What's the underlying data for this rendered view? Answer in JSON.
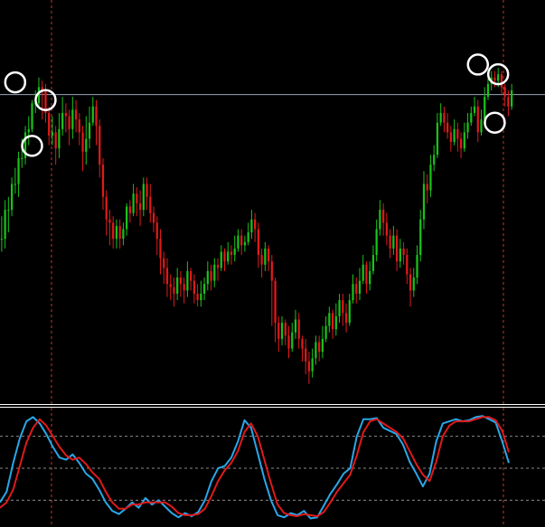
{
  "window": {
    "background": "#000000",
    "separator_color": "#ffffff",
    "grid_color": "#8a8a8a",
    "vline_color": "#c0392b"
  },
  "chart_data": [
    {
      "type": "candlestick",
      "colors": {
        "bull": "#19c219",
        "bear": "#e01a1a",
        "level": "#9aa6b8",
        "marker": "#ffffff"
      },
      "candles": [
        [
          0.47,
          0.47,
          0.43,
          0.54
        ],
        [
          0.47,
          0.56,
          0.44,
          0.59
        ],
        [
          0.56,
          0.56,
          0.49,
          0.6
        ],
        [
          0.56,
          0.64,
          0.54,
          0.66
        ],
        [
          0.64,
          0.64,
          0.61,
          0.69
        ],
        [
          0.64,
          0.72,
          0.6,
          0.74
        ],
        [
          0.72,
          0.72,
          0.69,
          0.78
        ],
        [
          0.72,
          0.8,
          0.7,
          0.82
        ],
        [
          0.8,
          0.81,
          0.76,
          0.85
        ],
        [
          0.81,
          0.89,
          0.8,
          0.9
        ],
        [
          0.89,
          0.89,
          0.86,
          0.93
        ],
        [
          0.89,
          0.94,
          0.88,
          0.97
        ],
        [
          0.94,
          0.93,
          0.84,
          0.96
        ],
        [
          0.93,
          0.86,
          0.83,
          0.95
        ],
        [
          0.86,
          0.79,
          0.76,
          0.88
        ],
        [
          0.79,
          0.8,
          0.76,
          0.85
        ],
        [
          0.8,
          0.75,
          0.7,
          0.82
        ],
        [
          0.75,
          0.81,
          0.72,
          0.86
        ],
        [
          0.81,
          0.86,
          0.79,
          0.91
        ],
        [
          0.86,
          0.85,
          0.8,
          0.89
        ],
        [
          0.85,
          0.81,
          0.76,
          0.87
        ],
        [
          0.81,
          0.87,
          0.78,
          0.91
        ],
        [
          0.87,
          0.84,
          0.8,
          0.9
        ],
        [
          0.84,
          0.8,
          0.76,
          0.86
        ],
        [
          0.8,
          0.74,
          0.68,
          0.82
        ],
        [
          0.74,
          0.78,
          0.7,
          0.85
        ],
        [
          0.78,
          0.83,
          0.75,
          0.88
        ],
        [
          0.83,
          0.88,
          0.82,
          0.91
        ],
        [
          0.88,
          0.82,
          0.76,
          0.9
        ],
        [
          0.82,
          0.7,
          0.66,
          0.84
        ],
        [
          0.7,
          0.6,
          0.56,
          0.72
        ],
        [
          0.6,
          0.53,
          0.48,
          0.62
        ],
        [
          0.53,
          0.52,
          0.45,
          0.56
        ],
        [
          0.52,
          0.47,
          0.44,
          0.54
        ],
        [
          0.47,
          0.51,
          0.44,
          0.53
        ],
        [
          0.51,
          0.47,
          0.44,
          0.53
        ],
        [
          0.47,
          0.5,
          0.45,
          0.52
        ],
        [
          0.5,
          0.57,
          0.48,
          0.58
        ],
        [
          0.57,
          0.55,
          0.52,
          0.59
        ],
        [
          0.55,
          0.61,
          0.54,
          0.64
        ],
        [
          0.61,
          0.58,
          0.54,
          0.63
        ],
        [
          0.58,
          0.56,
          0.51,
          0.62
        ],
        [
          0.56,
          0.64,
          0.54,
          0.66
        ],
        [
          0.64,
          0.6,
          0.56,
          0.66
        ],
        [
          0.6,
          0.55,
          0.52,
          0.64
        ],
        [
          0.55,
          0.52,
          0.49,
          0.57
        ],
        [
          0.52,
          0.47,
          0.42,
          0.54
        ],
        [
          0.47,
          0.41,
          0.36,
          0.5
        ],
        [
          0.41,
          0.38,
          0.33,
          0.43
        ],
        [
          0.38,
          0.33,
          0.29,
          0.41
        ],
        [
          0.33,
          0.32,
          0.28,
          0.36
        ],
        [
          0.32,
          0.3,
          0.26,
          0.35
        ],
        [
          0.3,
          0.35,
          0.28,
          0.38
        ],
        [
          0.35,
          0.33,
          0.29,
          0.37
        ],
        [
          0.33,
          0.31,
          0.27,
          0.35
        ],
        [
          0.31,
          0.37,
          0.29,
          0.4
        ],
        [
          0.37,
          0.34,
          0.31,
          0.38
        ],
        [
          0.34,
          0.3,
          0.27,
          0.36
        ],
        [
          0.3,
          0.28,
          0.26,
          0.33
        ],
        [
          0.28,
          0.3,
          0.26,
          0.34
        ],
        [
          0.3,
          0.33,
          0.28,
          0.35
        ],
        [
          0.33,
          0.37,
          0.31,
          0.4
        ],
        [
          0.37,
          0.34,
          0.31,
          0.39
        ],
        [
          0.34,
          0.39,
          0.32,
          0.41
        ],
        [
          0.39,
          0.38,
          0.34,
          0.41
        ],
        [
          0.38,
          0.43,
          0.37,
          0.45
        ],
        [
          0.43,
          0.4,
          0.37,
          0.44
        ],
        [
          0.4,
          0.43,
          0.39,
          0.46
        ],
        [
          0.43,
          0.42,
          0.39,
          0.45
        ],
        [
          0.42,
          0.44,
          0.4,
          0.48
        ],
        [
          0.44,
          0.48,
          0.43,
          0.5
        ],
        [
          0.48,
          0.45,
          0.42,
          0.5
        ],
        [
          0.45,
          0.46,
          0.43,
          0.48
        ],
        [
          0.46,
          0.49,
          0.45,
          0.52
        ],
        [
          0.49,
          0.53,
          0.47,
          0.56
        ],
        [
          0.53,
          0.5,
          0.46,
          0.55
        ],
        [
          0.5,
          0.42,
          0.38,
          0.52
        ],
        [
          0.42,
          0.39,
          0.35,
          0.44
        ],
        [
          0.39,
          0.44,
          0.37,
          0.46
        ],
        [
          0.44,
          0.4,
          0.37,
          0.45
        ],
        [
          0.4,
          0.34,
          0.2,
          0.42
        ],
        [
          0.34,
          0.21,
          0.15,
          0.35
        ],
        [
          0.21,
          0.16,
          0.12,
          0.23
        ],
        [
          0.16,
          0.21,
          0.14,
          0.23
        ],
        [
          0.21,
          0.17,
          0.14,
          0.22
        ],
        [
          0.17,
          0.13,
          0.1,
          0.2
        ],
        [
          0.13,
          0.18,
          0.12,
          0.21
        ],
        [
          0.18,
          0.22,
          0.16,
          0.25
        ],
        [
          0.22,
          0.16,
          0.13,
          0.24
        ],
        [
          0.16,
          0.13,
          0.09,
          0.17
        ],
        [
          0.13,
          0.09,
          0.05,
          0.16
        ],
        [
          0.09,
          0.06,
          0.02,
          0.12
        ],
        [
          0.06,
          0.1,
          0.04,
          0.13
        ],
        [
          0.1,
          0.15,
          0.08,
          0.17
        ],
        [
          0.15,
          0.12,
          0.09,
          0.17
        ],
        [
          0.12,
          0.16,
          0.1,
          0.2
        ],
        [
          0.16,
          0.2,
          0.15,
          0.23
        ],
        [
          0.2,
          0.24,
          0.18,
          0.26
        ],
        [
          0.24,
          0.19,
          0.16,
          0.25
        ],
        [
          0.19,
          0.23,
          0.17,
          0.27
        ],
        [
          0.23,
          0.28,
          0.21,
          0.3
        ],
        [
          0.28,
          0.24,
          0.2,
          0.3
        ],
        [
          0.24,
          0.21,
          0.18,
          0.27
        ],
        [
          0.21,
          0.28,
          0.2,
          0.3
        ],
        [
          0.28,
          0.33,
          0.27,
          0.36
        ],
        [
          0.33,
          0.3,
          0.27,
          0.35
        ],
        [
          0.3,
          0.34,
          0.28,
          0.38
        ],
        [
          0.34,
          0.39,
          0.33,
          0.42
        ],
        [
          0.39,
          0.33,
          0.3,
          0.4
        ],
        [
          0.33,
          0.37,
          0.31,
          0.4
        ],
        [
          0.37,
          0.42,
          0.36,
          0.45
        ],
        [
          0.42,
          0.5,
          0.4,
          0.53
        ],
        [
          0.5,
          0.56,
          0.48,
          0.59
        ],
        [
          0.56,
          0.52,
          0.48,
          0.58
        ],
        [
          0.52,
          0.48,
          0.45,
          0.55
        ],
        [
          0.48,
          0.44,
          0.41,
          0.5
        ],
        [
          0.44,
          0.48,
          0.42,
          0.51
        ],
        [
          0.48,
          0.4,
          0.37,
          0.5
        ],
        [
          0.4,
          0.44,
          0.38,
          0.47
        ],
        [
          0.44,
          0.42,
          0.39,
          0.46
        ],
        [
          0.42,
          0.36,
          0.33,
          0.44
        ],
        [
          0.36,
          0.31,
          0.26,
          0.38
        ],
        [
          0.31,
          0.35,
          0.29,
          0.38
        ],
        [
          0.35,
          0.42,
          0.33,
          0.45
        ],
        [
          0.42,
          0.53,
          0.4,
          0.56
        ],
        [
          0.53,
          0.64,
          0.5,
          0.68
        ],
        [
          0.64,
          0.62,
          0.58,
          0.67
        ],
        [
          0.62,
          0.7,
          0.6,
          0.73
        ],
        [
          0.7,
          0.73,
          0.68,
          0.76
        ],
        [
          0.73,
          0.83,
          0.72,
          0.86
        ],
        [
          0.83,
          0.86,
          0.82,
          0.89
        ],
        [
          0.86,
          0.83,
          0.8,
          0.88
        ],
        [
          0.83,
          0.8,
          0.78,
          0.86
        ],
        [
          0.8,
          0.77,
          0.74,
          0.82
        ],
        [
          0.77,
          0.81,
          0.76,
          0.84
        ],
        [
          0.81,
          0.78,
          0.74,
          0.83
        ],
        [
          0.78,
          0.75,
          0.72,
          0.8
        ],
        [
          0.75,
          0.8,
          0.74,
          0.83
        ],
        [
          0.8,
          0.83,
          0.78,
          0.86
        ],
        [
          0.83,
          0.86,
          0.82,
          0.88
        ],
        [
          0.86,
          0.88,
          0.85,
          0.91
        ],
        [
          0.88,
          0.8,
          0.77,
          0.9
        ],
        [
          0.8,
          0.84,
          0.79,
          0.87
        ],
        [
          0.84,
          0.91,
          0.83,
          0.94
        ],
        [
          0.91,
          0.95,
          0.9,
          0.97
        ],
        [
          0.95,
          0.97,
          0.93,
          0.99
        ],
        [
          0.97,
          0.96,
          0.94,
          0.99
        ],
        [
          0.96,
          0.98,
          0.94,
          1.0
        ],
        [
          0.98,
          0.94,
          0.92,
          0.99
        ],
        [
          0.94,
          0.91,
          0.88,
          0.95
        ],
        [
          0.91,
          0.88,
          0.85,
          0.93
        ],
        [
          0.88,
          0.93,
          0.87,
          0.95
        ]
      ],
      "level": 0.917,
      "markers": [
        {
          "label": "circle-peak-1",
          "i": 4,
          "price": 0.955
        },
        {
          "label": "circle-trough-1",
          "i": 9,
          "price": 0.758
        },
        {
          "label": "circle-peak-2",
          "i": 13,
          "price": 0.9
        },
        {
          "label": "circle-peak-3",
          "i": 141,
          "price": 1.01
        },
        {
          "label": "circle-peak-4",
          "i": 147,
          "price": 0.98
        },
        {
          "label": "circle-trough-2",
          "i": 146,
          "price": 0.83
        }
      ]
    },
    {
      "type": "line",
      "levels": [
        80,
        50,
        20
      ],
      "ylim": [
        0,
        100
      ],
      "series": [
        {
          "color": "#2aa7e8",
          "values": [
            18,
            28,
            55,
            78,
            94,
            98,
            92,
            82,
            70,
            60,
            58,
            63,
            55,
            45,
            40,
            30,
            18,
            10,
            7,
            12,
            18,
            13,
            22,
            16,
            20,
            14,
            8,
            4,
            8,
            5,
            9,
            20,
            38,
            50,
            52,
            60,
            75,
            95,
            88,
            64,
            40,
            20,
            6,
            4,
            8,
            6,
            10,
            3,
            4,
            15,
            26,
            35,
            45,
            50,
            80,
            96,
            96,
            97,
            88,
            85,
            82,
            72,
            56,
            45,
            33,
            45,
            75,
            92,
            94,
            96,
            94,
            95,
            98,
            99,
            96,
            93,
            75,
            55
          ]
        },
        {
          "color": "#e01a1a",
          "values": [
            13,
            18,
            30,
            52,
            74,
            88,
            96,
            90,
            80,
            70,
            62,
            58,
            60,
            54,
            46,
            40,
            28,
            18,
            12,
            12,
            16,
            16,
            18,
            18,
            18,
            18,
            14,
            8,
            6,
            6,
            7,
            12,
            24,
            38,
            48,
            55,
            66,
            84,
            92,
            80,
            58,
            36,
            16,
            8,
            6,
            5,
            7,
            6,
            5,
            9,
            18,
            28,
            36,
            44,
            62,
            84,
            94,
            96,
            92,
            88,
            84,
            78,
            66,
            54,
            44,
            38,
            56,
            80,
            90,
            94,
            94,
            94,
            96,
            98,
            98,
            95,
            85,
            65
          ]
        }
      ]
    }
  ]
}
